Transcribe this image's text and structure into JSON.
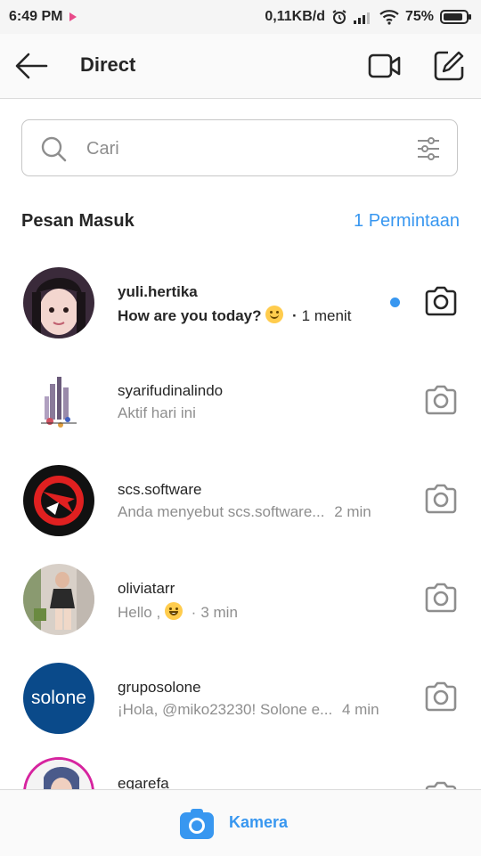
{
  "status_bar": {
    "time": "6:49 PM",
    "network_speed": "0,11KB/d",
    "battery": "75%"
  },
  "header": {
    "title": "Direct",
    "back_icon": "arrow-left-icon",
    "video_icon": "video-camera-icon",
    "compose_icon": "compose-icon"
  },
  "search": {
    "placeholder": "Cari",
    "value": ""
  },
  "section": {
    "title": "Pesan Masuk",
    "requests_link": "1 Permintaan"
  },
  "threads": [
    {
      "username": "yuli.hertika",
      "message": "How are you today?",
      "emoji": "smiling-face",
      "time": "1 menit",
      "unread": true
    },
    {
      "username": "syarifudinalindo",
      "message": "Aktif hari ini",
      "time": ""
    },
    {
      "username": "scs.software",
      "message": "Anda menyebut scs.software...",
      "time": "2 min"
    },
    {
      "username": "oliviatarr",
      "message": "Hello ,",
      "emoji": "grinning-face",
      "time": "3 min"
    },
    {
      "username": "gruposolone",
      "message": "¡Hola, @miko23230! Solone e...",
      "time": "4 min",
      "avatar_text": "solone"
    },
    {
      "username": "egarefa",
      "message": "",
      "time": ""
    }
  ],
  "bottom_bar": {
    "label": "Kamera",
    "icon": "camera-icon"
  },
  "colors": {
    "accent": "#3897f0",
    "text": "#262626",
    "secondary_text": "#8e8e8e"
  }
}
